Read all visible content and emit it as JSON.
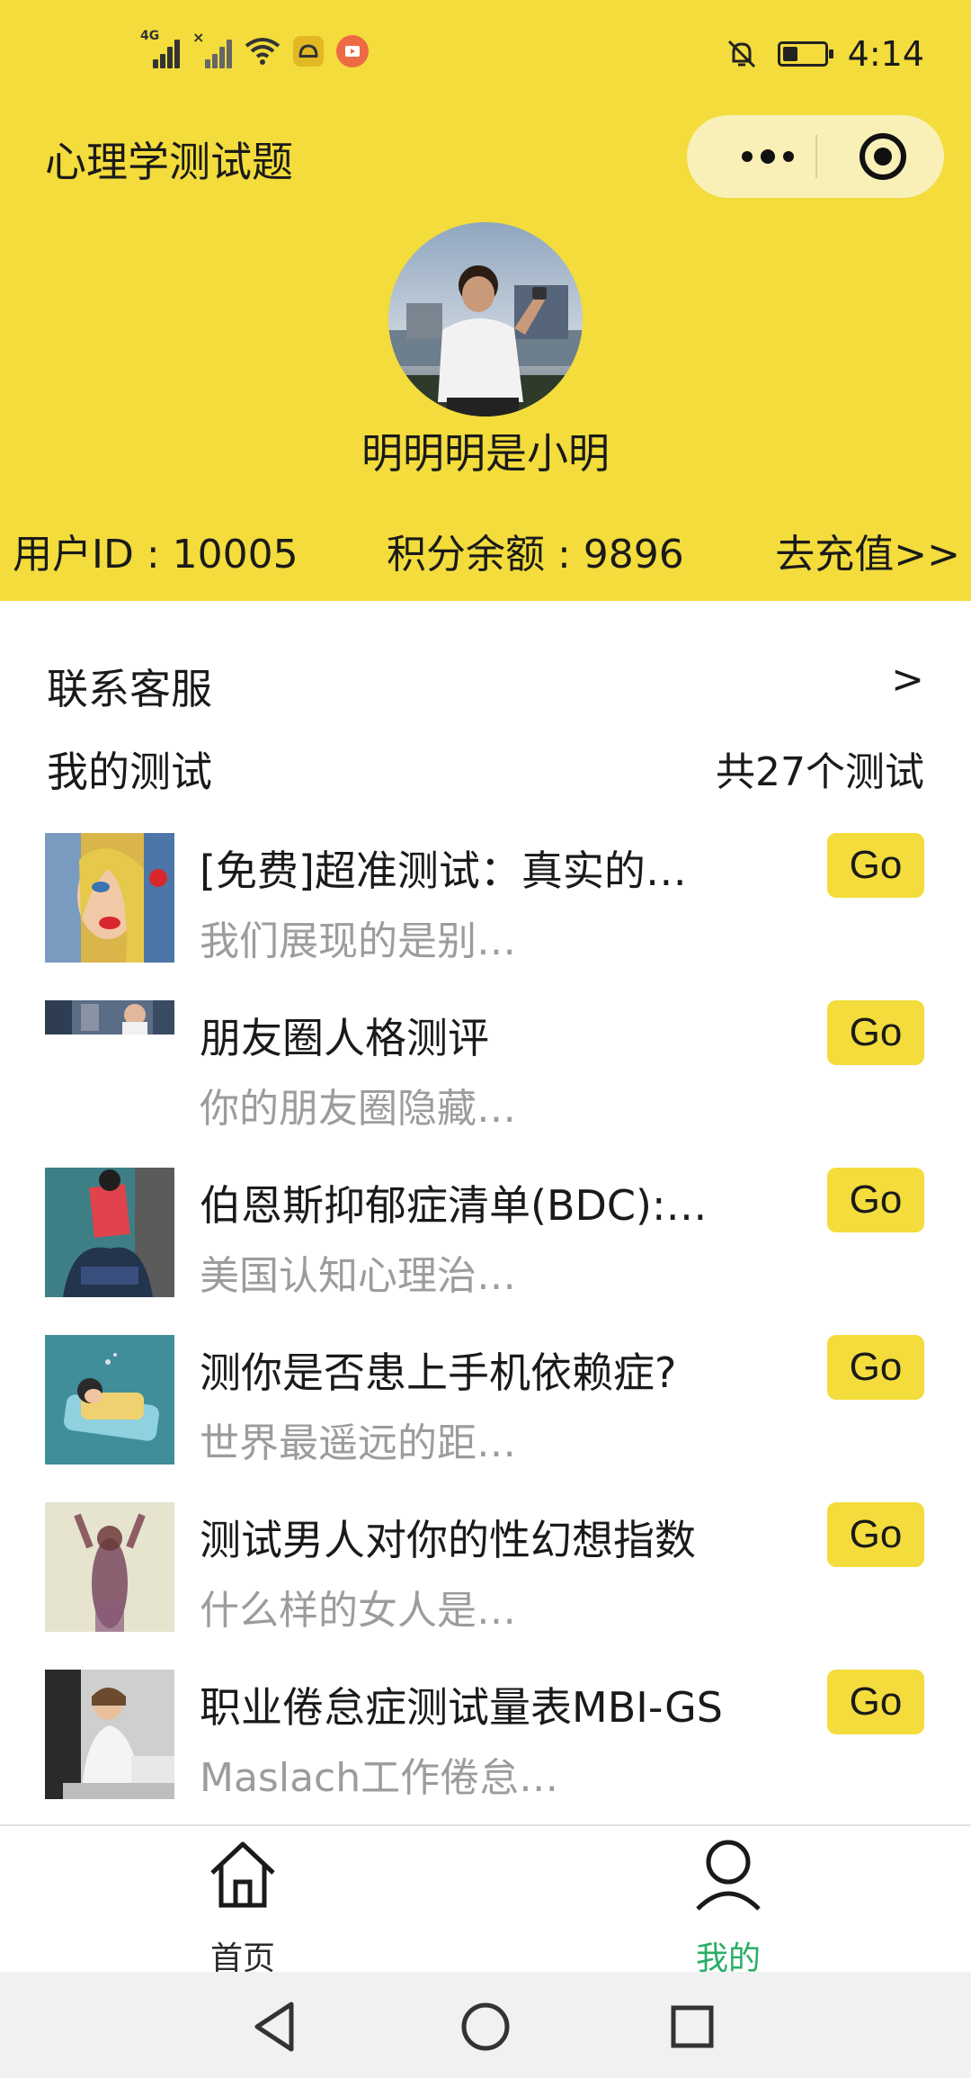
{
  "status_bar": {
    "network_label": "4G",
    "time": "4:14",
    "battery_level": 0.3,
    "icons": [
      "signal-icon",
      "signal-no-sim-icon",
      "wifi-icon",
      "app-notification-icon",
      "video-notification-icon",
      "mute-bell-icon",
      "battery-icon"
    ]
  },
  "header": {
    "app_title": "心理学测试题",
    "capsule": {
      "more_icon": "more-dots-icon",
      "close_icon": "target-circle-icon"
    },
    "username": "明明明是小明",
    "user_id_text": "用户ID : 10005",
    "points_text": "积分余额 : 9896",
    "recharge_text": "去充值>>",
    "accent_color": "#f3dc3c"
  },
  "contact": {
    "label": "联系客服",
    "chevron": ">"
  },
  "my_tests": {
    "label": "我的测试",
    "count_text": "共27个测试"
  },
  "tests": [
    {
      "title": "[免费]超准测试：真实的…",
      "desc": "我们展现的是别…",
      "button": "Go"
    },
    {
      "title": "朋友圈人格测评",
      "desc": "你的朋友圈隐藏…",
      "button": "Go"
    },
    {
      "title": "伯恩斯抑郁症清单(BDC):…",
      "desc": "美国认知心理治…",
      "button": "Go"
    },
    {
      "title": "测你是否患上手机依赖症?",
      "desc": "世界最遥远的距…",
      "button": "Go"
    },
    {
      "title": "测试男人对你的性幻想指数",
      "desc": "什么样的女人是…",
      "button": "Go"
    },
    {
      "title": "职业倦怠症测试量表MBI-GS",
      "desc": "Maslach工作倦怠…",
      "button": "Go"
    }
  ],
  "tabbar": {
    "items": [
      {
        "label": "首页",
        "icon": "home-icon",
        "active": false
      },
      {
        "label": "我的",
        "icon": "user-icon",
        "active": true
      }
    ],
    "active_color": "#2aae67"
  },
  "android_nav": {
    "icons": [
      "back-triangle-icon",
      "home-circle-icon",
      "recent-square-icon"
    ]
  }
}
